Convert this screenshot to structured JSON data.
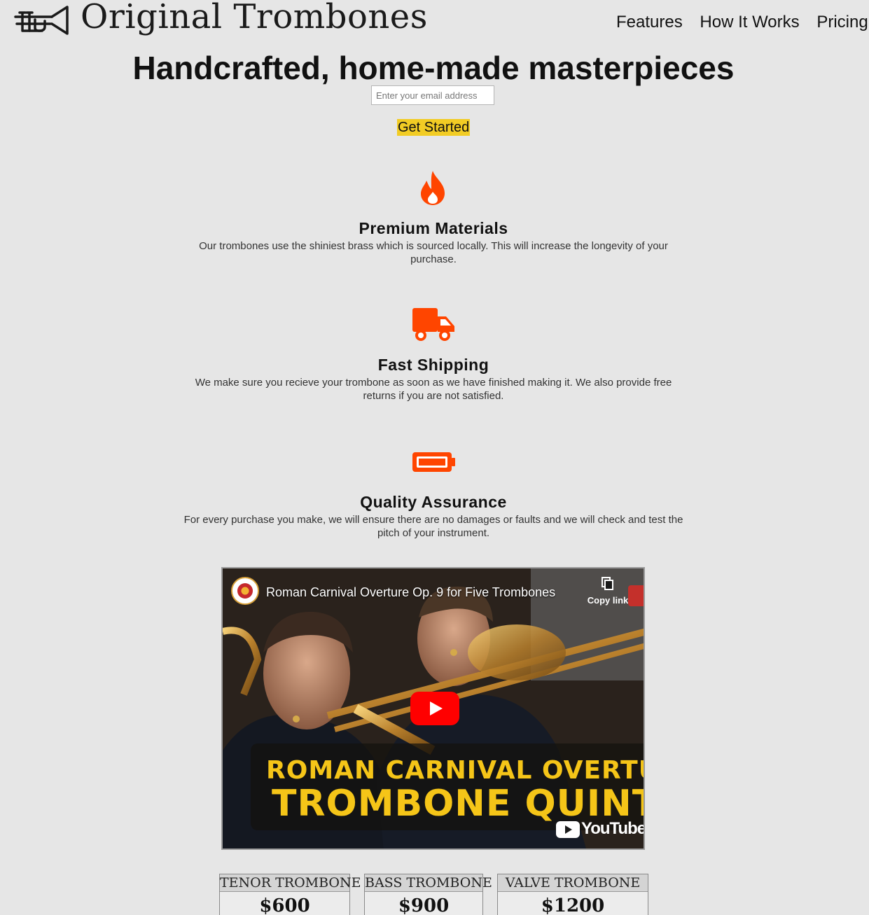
{
  "header": {
    "brand": "Original Trombones",
    "logo_icon": "trombone-icon",
    "nav": [
      {
        "label": "Features"
      },
      {
        "label": "How It Works"
      },
      {
        "label": "Pricing"
      }
    ]
  },
  "hero": {
    "title": "Handcrafted, home-made masterpieces",
    "email_placeholder": "Enter your email address",
    "cta_label": "Get Started"
  },
  "features": [
    {
      "icon": "fire-icon",
      "title": "Premium Materials",
      "description": "Our trombones use the shiniest brass which is sourced locally. This will increase the longevity of your purchase."
    },
    {
      "icon": "truck-icon",
      "title": "Fast Shipping",
      "description": "We make sure you recieve your trombone as soon as we have finished making it. We also provide free returns if you are not satisfied."
    },
    {
      "icon": "battery-icon",
      "title": "Quality Assurance",
      "description": "For every purchase you make, we will ensure there are no damages or faults and we will check and test the pitch of your instrument."
    }
  ],
  "video": {
    "title": "Roman Carnival Overture Op. 9 for Five Trombones",
    "copy_link_label": "Copy link",
    "overlay_line1": "ROMAN CARNIVAL OVERTUR",
    "overlay_line2": "TROMBONE QUINTE",
    "platform": "YouTube"
  },
  "pricing": [
    {
      "name": "TENOR TROMBONE",
      "price": "$600"
    },
    {
      "name": "BASS TROMBONE",
      "price": "$900"
    },
    {
      "name": "VALVE TROMBONE",
      "price": "$1200"
    }
  ],
  "colors": {
    "background": "#e6e6e6",
    "accent_icon": "#ff4500",
    "cta": "#f2cc24"
  }
}
